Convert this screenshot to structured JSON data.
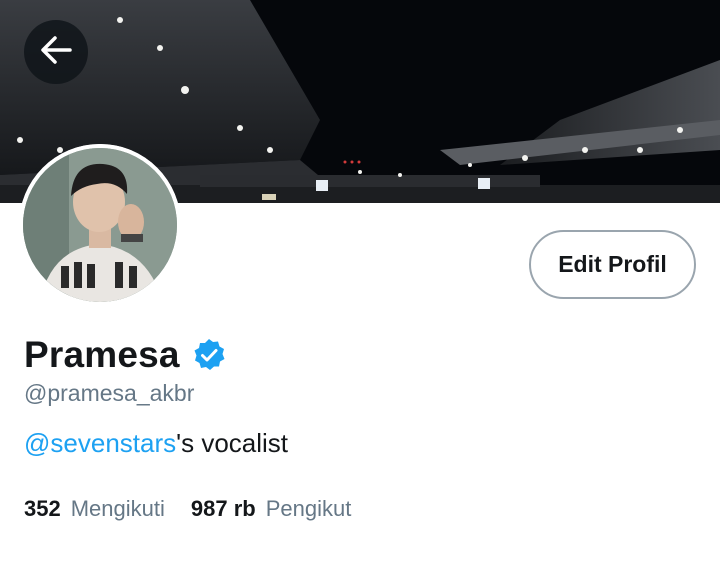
{
  "profile": {
    "name": "Pramesa",
    "handle": "@pramesa_akbr",
    "verified": true,
    "bio_mention": "@sevenstars",
    "bio_rest": "'s vocalist"
  },
  "actions": {
    "edit_label": "Edit Profil",
    "back_icon": "arrow-left-icon"
  },
  "stats": {
    "following_count": "352",
    "following_label": "Mengikuti",
    "followers_count": "987 rb",
    "followers_label": "Pengikut"
  },
  "colors": {
    "accent": "#1da1f2",
    "text": "#14171a",
    "secondary": "#657786",
    "border": "#9aa5ae"
  }
}
